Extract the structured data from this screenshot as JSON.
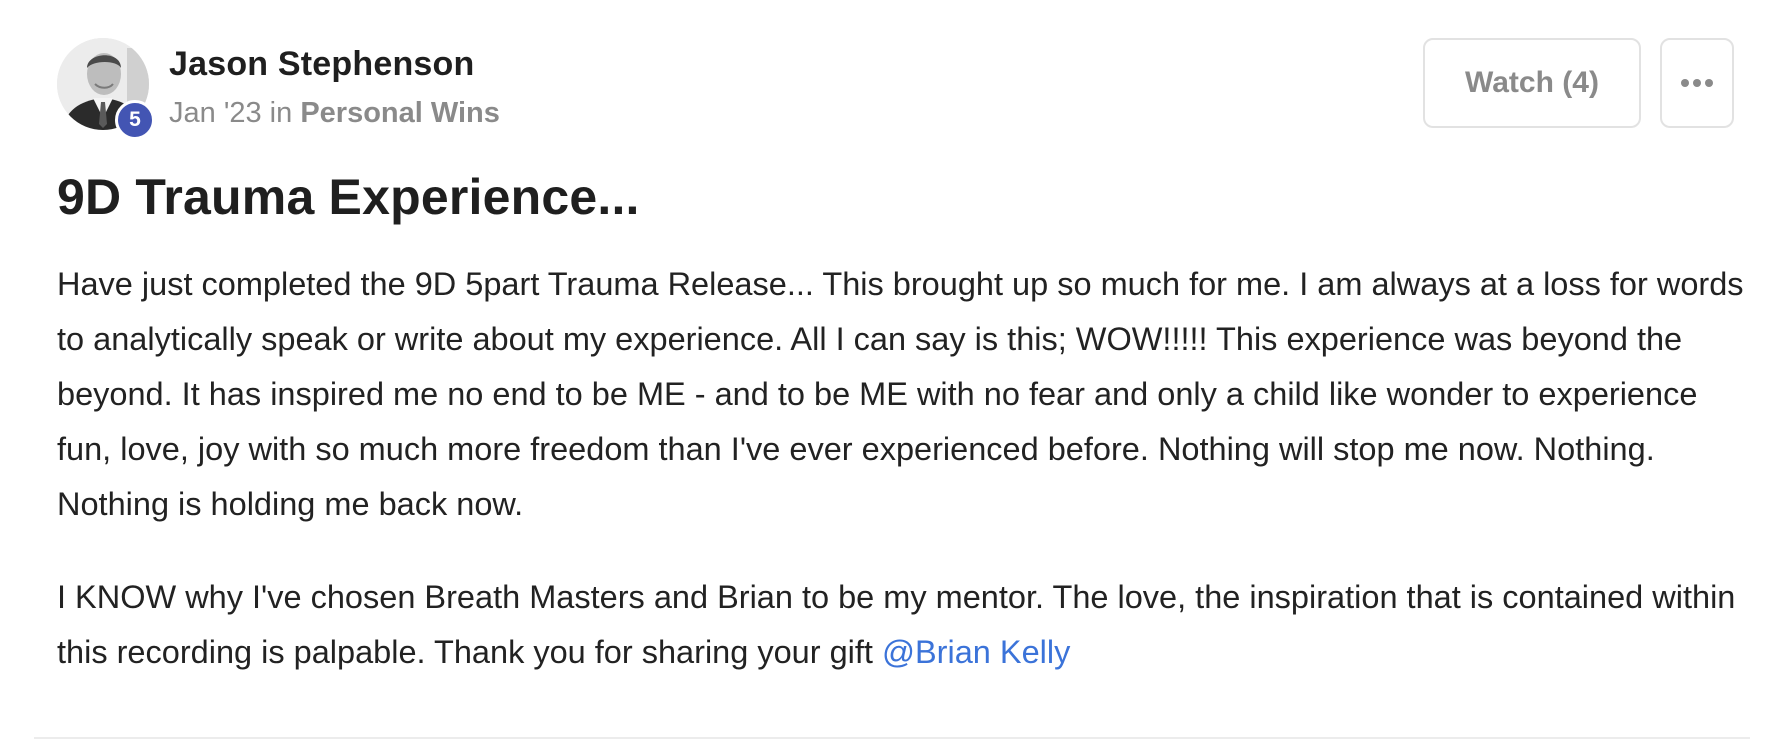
{
  "post": {
    "author": {
      "name": "Jason Stephenson",
      "level": "5",
      "avatar_icon": "profile-photo"
    },
    "date": "Jan '23",
    "in_label": "in",
    "category": "Personal Wins",
    "actions": {
      "watch_label": "Watch (4)",
      "more_icon": "ellipsis-icon"
    },
    "title": "9D Trauma Experience...",
    "paragraph_1": "Have just completed the 9D 5part Trauma Release... This brought up so much for me. I am always at a loss for words to analytically speak or write about my experience. All I can say is this; WOW!!!!! This experience was beyond the beyond. It has inspired me no end to be ME - and to be ME with no fear and only a child like wonder to experience fun, love, joy with so much more freedom than I've ever experienced before. Nothing will stop me now. Nothing. Nothing is holding me back now.",
    "paragraph_2": "I KNOW why I've chosen Breath Masters and Brian to be my mentor. The love, the inspiration that is contained within this recording is palpable. Thank you for sharing your gift",
    "mention": "@Brian Kelly"
  },
  "colors": {
    "level_badge": "#4355b3",
    "mention": "#3b73d9",
    "muted_text": "#8a8a8a",
    "border": "#e2e2e2"
  }
}
